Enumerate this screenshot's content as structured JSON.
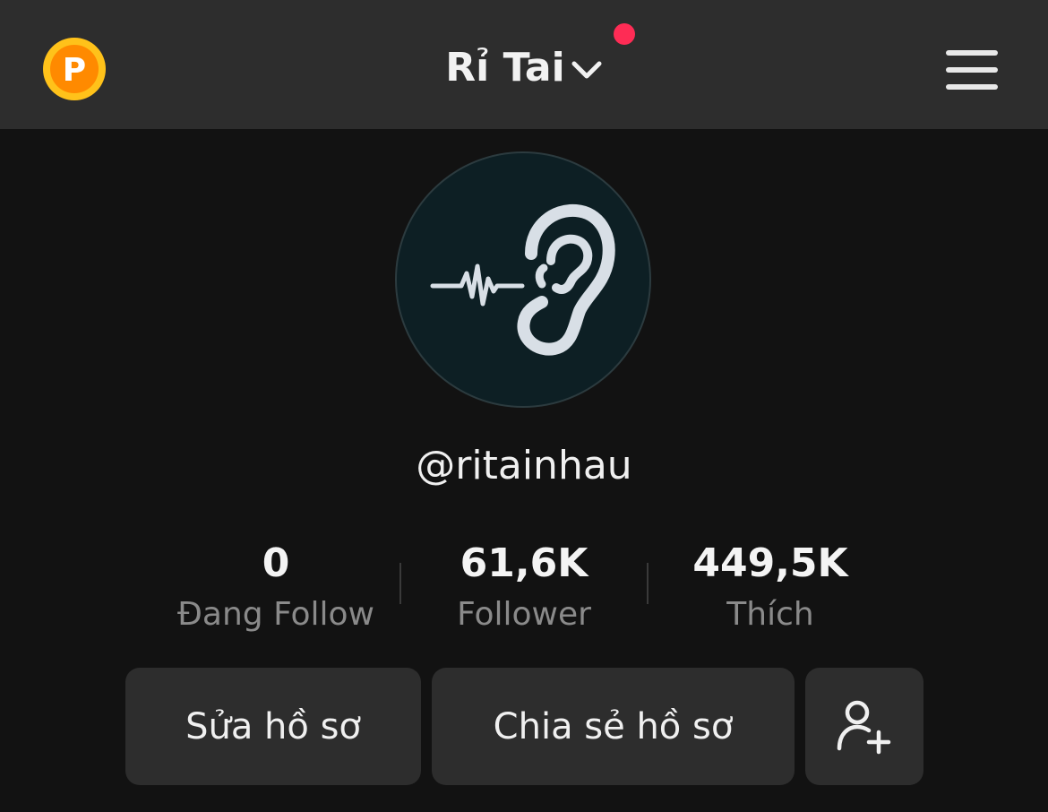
{
  "header": {
    "title": "Rỉ Tai",
    "coin_icon": "points-coin-icon",
    "coin_letter": "P",
    "dropdown_icon": "chevron-down-icon",
    "menu_icon": "hamburger-menu-icon",
    "notification_color": "#fe2c55"
  },
  "profile": {
    "avatar_icon": "ear-soundwave-icon",
    "handle": "@ritainhau"
  },
  "stats": [
    {
      "value": "0",
      "label": "Đang Follow"
    },
    {
      "value": "61,6K",
      "label": "Follower"
    },
    {
      "value": "449,5K",
      "label": "Thích"
    }
  ],
  "actions": {
    "edit_label": "Sửa hồ sơ",
    "share_label": "Chia sẻ hồ sơ",
    "add_friend_icon": "add-person-icon"
  },
  "colors": {
    "background": "#121212",
    "header_bg": "#2d2d2d",
    "button_bg": "#2d2d2d",
    "coin": "#ffb700",
    "avatar_bg": "#0d1f24"
  }
}
